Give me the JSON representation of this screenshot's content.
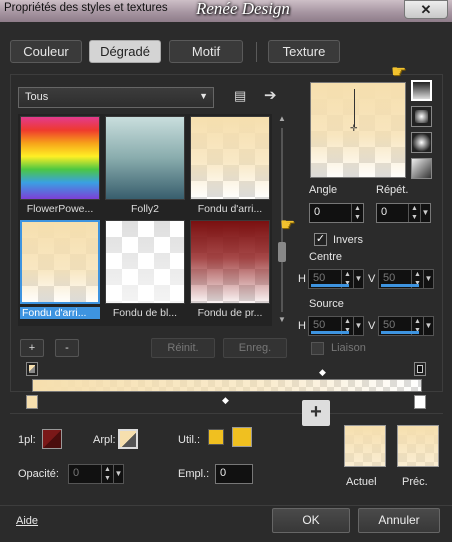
{
  "window": {
    "title": "Propriétés des styles et textures",
    "watermark": "Renée Design",
    "close_glyph": "✕"
  },
  "tabs": [
    {
      "label": "Couleur"
    },
    {
      "label": "Dégradé",
      "selected": true
    },
    {
      "label": "Motif"
    },
    {
      "label": "Texture"
    }
  ],
  "preset": {
    "value": "Tous",
    "icons": [
      "list-icon",
      "arrow-right-icon"
    ]
  },
  "gradients": [
    {
      "name": "FlowerPowe...",
      "kind": "rainbow"
    },
    {
      "name": "Folly2",
      "kind": "teal"
    },
    {
      "name": "Fondu d'arri...",
      "kind": "cream-fade"
    },
    {
      "name": "Fondu d'arri...",
      "kind": "cream",
      "selected": true
    },
    {
      "name": "Fondu de bl...",
      "kind": "white"
    },
    {
      "name": "Fondu de pr...",
      "kind": "red"
    }
  ],
  "buttons": {
    "add": "+",
    "remove": "-",
    "reset": "Réinit.",
    "save": "Enreg.",
    "ok": "OK",
    "cancel": "Annuler",
    "help": "Aide",
    "add_swatch": "+"
  },
  "angle": {
    "label": "Angle",
    "value": "0"
  },
  "repeat": {
    "label": "Répét.",
    "value": "0"
  },
  "invert": {
    "label": "Invers",
    "checked": true
  },
  "center": {
    "label": "Centre",
    "h_label": "H",
    "h_value": "50",
    "v_label": "V",
    "v_value": "50"
  },
  "source": {
    "label": "Source",
    "h_label": "H",
    "h_value": "50",
    "v_label": "V",
    "v_value": "50"
  },
  "link": {
    "label": "Liaison",
    "checked": false
  },
  "stop_props": {
    "first_label": "1pl:",
    "first_color": "#7a1818",
    "arpl_label": "Arpl:",
    "util_label": "Util.:",
    "util_color": "#f0c020",
    "opacity_label": "Opacité:",
    "opacity_value": "0",
    "location_label": "Empl.:",
    "location_value": "0"
  },
  "swatches": {
    "current_label": "Actuel",
    "previous_label": "Préc."
  },
  "colors": {
    "cream": "#f6dfae",
    "accent": "#3e94e0",
    "hand": "#f2c22e"
  }
}
